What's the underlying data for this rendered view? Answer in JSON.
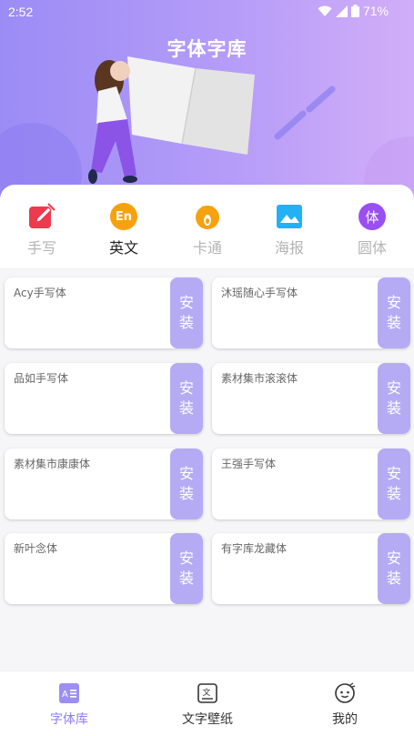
{
  "status": {
    "time": "2:52",
    "battery": "71%"
  },
  "header": {
    "title": "字体字库"
  },
  "categories": [
    {
      "label": "手写",
      "icon": "pen-icon",
      "color": "#ee3a4f",
      "active": false
    },
    {
      "label": "英文",
      "icon": "en-icon",
      "badge": "En",
      "color": "#f7a10f",
      "active": true
    },
    {
      "label": "卡通",
      "icon": "cartoon-icon",
      "color": "#f6a10e",
      "active": false
    },
    {
      "label": "海报",
      "icon": "poster-icon",
      "color": "#23b1f5",
      "active": false
    },
    {
      "label": "圆体",
      "icon": "round-font-icon",
      "badge": "体",
      "color": "#9a4ff2",
      "active": false
    }
  ],
  "install_label": [
    "安",
    "装"
  ],
  "fonts": [
    {
      "name": "Acy手写体"
    },
    {
      "name": "沐瑶随心手写体"
    },
    {
      "name": "品如手写体"
    },
    {
      "name": "素材集市滚滚体"
    },
    {
      "name": "素材集市康康体"
    },
    {
      "name": "王强手写体"
    },
    {
      "name": "新叶念体"
    },
    {
      "name": "有字库龙藏体"
    }
  ],
  "tabs": [
    {
      "label": "字体库",
      "icon": "font-library-icon",
      "active": true
    },
    {
      "label": "文字壁纸",
      "icon": "text-wallpaper-icon",
      "active": false
    },
    {
      "label": "我的",
      "icon": "profile-icon",
      "active": false
    }
  ],
  "colors": {
    "accent": "#8d7ef0",
    "install_button": "#b5abf4"
  }
}
